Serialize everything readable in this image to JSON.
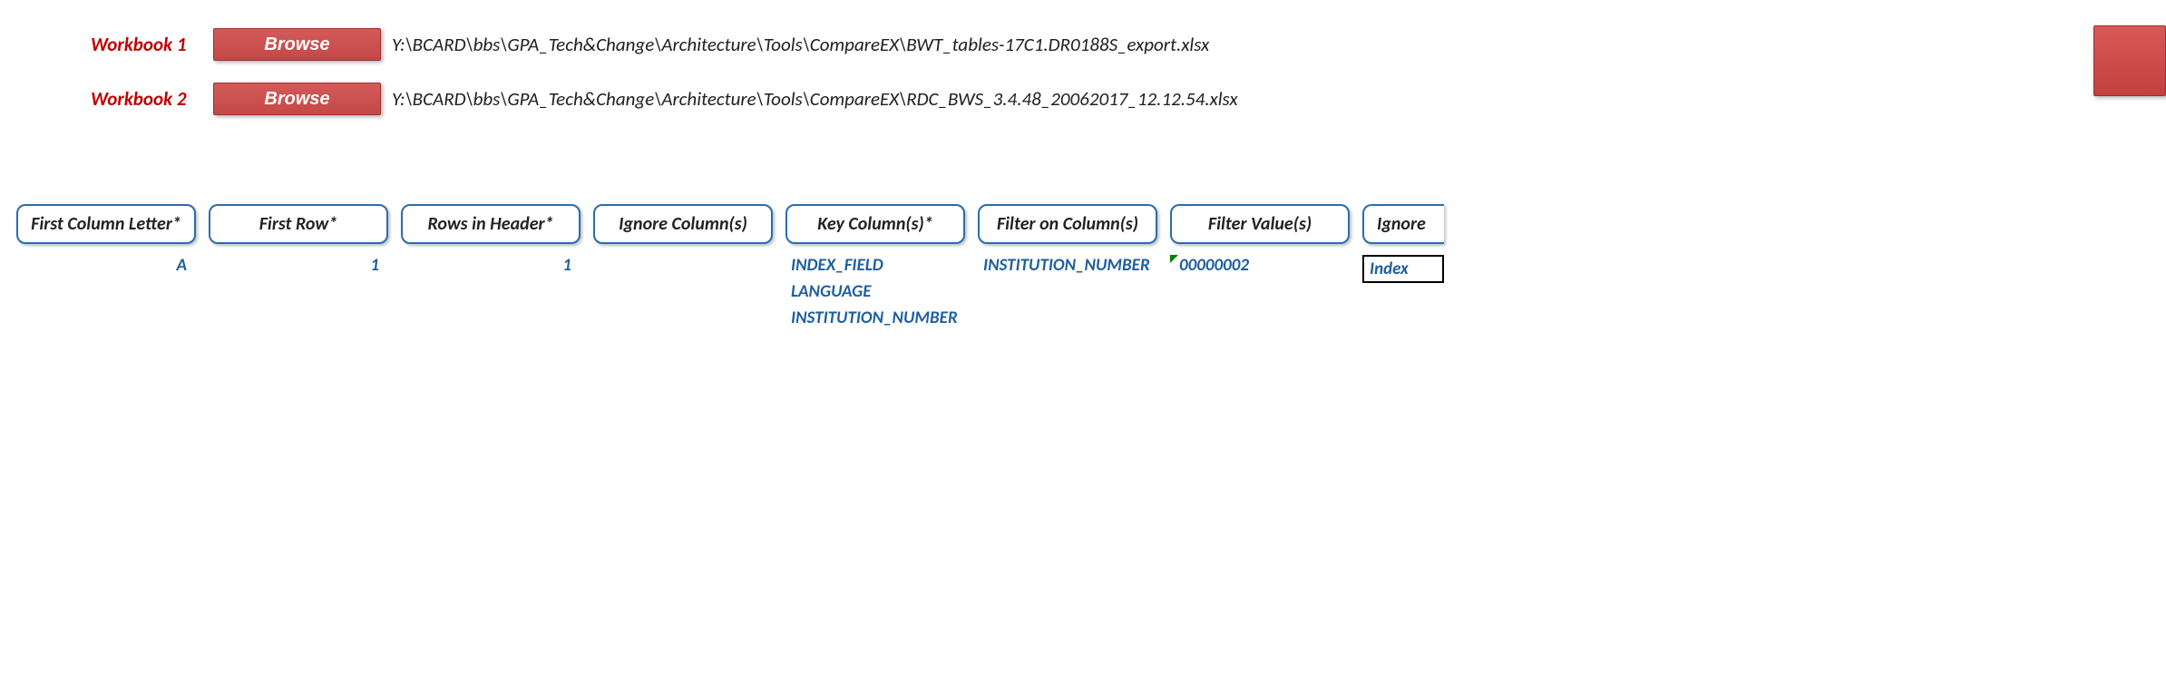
{
  "workbooks": {
    "wb1": {
      "label": "Workbook 1",
      "browse": "Browse",
      "path": "Y:\\BCARD\\bbs\\GPA_Tech&Change\\Architecture\\Tools\\CompareEX\\BWT_tables-17C1.DR0188S_export.xlsx"
    },
    "wb2": {
      "label": "Workbook 2",
      "browse": "Browse",
      "path": "Y:\\BCARD\\bbs\\GPA_Tech&Change\\Architecture\\Tools\\CompareEX\\RDC_BWS_3.4.48_20062017_12.12.54.xlsx"
    }
  },
  "columns": {
    "first_col_letter": {
      "header": "First Column Letter*",
      "value": "A"
    },
    "first_row": {
      "header": "First Row*",
      "value": "1"
    },
    "rows_in_header": {
      "header": "Rows in Header*",
      "value": "1"
    },
    "ignore_columns": {
      "header": "Ignore Column(s)"
    },
    "key_columns": {
      "header": "Key Column(s)*",
      "values": [
        "INDEX_FIELD",
        "LANGUAGE",
        "INSTITUTION_NUMBER"
      ]
    },
    "filter_on_columns": {
      "header": "Filter on Column(s)",
      "value": "INSTITUTION_NUMBER"
    },
    "filter_values": {
      "header": "Filter Value(s)",
      "value": "00000002"
    },
    "ignore2": {
      "header": "Ignore",
      "value": "Index"
    }
  }
}
